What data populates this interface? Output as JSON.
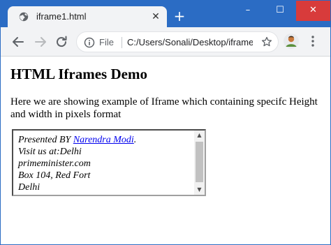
{
  "browser": {
    "tab": {
      "title": "iframe1.html",
      "favicon": "globe-icon",
      "close_glyph": "✕"
    },
    "new_tab_glyph": "+",
    "window_controls": {
      "minimize": "–",
      "maximize": "☐",
      "close": "✕"
    },
    "toolbar": {
      "back_icon": "back-arrow-icon",
      "forward_icon": "forward-arrow-icon",
      "reload_icon": "reload-icon",
      "address": {
        "info_icon": "info-icon",
        "scheme_label": "File",
        "url": "C:/Users/Sonali/Desktop/iframe..."
      },
      "bookmark_icon": "star-icon",
      "profile_icon": "profile-avatar",
      "menu_icon": "kebab-menu-icon"
    },
    "accent_color": "#2b6cc4",
    "close_color": "#d83b3b"
  },
  "page": {
    "heading": "HTML Iframes Demo",
    "description": "Here we are showing example of Iframe which containing specifc Height and width in pixels format",
    "iframe": {
      "presented_prefix": "Presented BY ",
      "presenter_link": "Narendra Modi",
      "presented_suffix": ".",
      "lines": [
        "Visit us at:Delhi",
        "primeminister.com",
        "Box 104, Red Fort",
        "Delhi"
      ],
      "scroll_up_glyph": "▲",
      "scroll_down_glyph": "▼"
    }
  }
}
